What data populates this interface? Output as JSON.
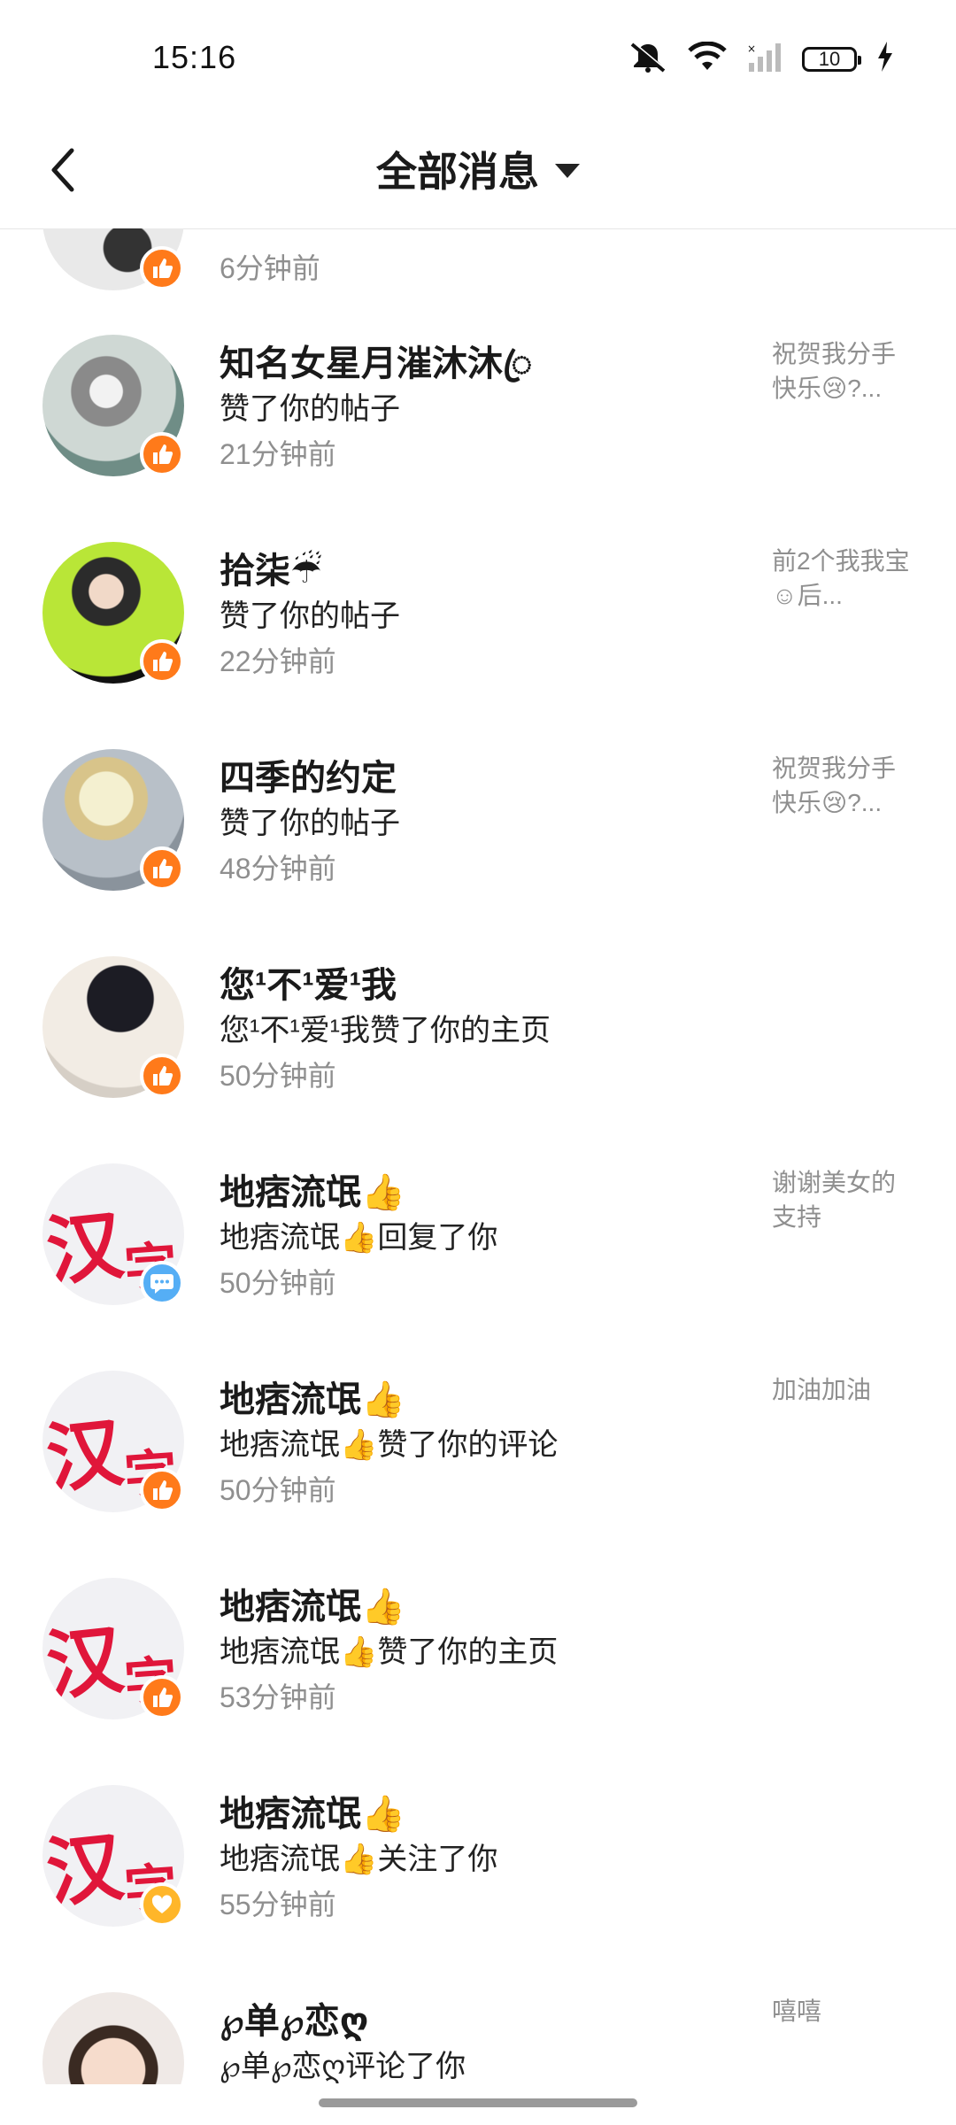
{
  "status_bar": {
    "time": "15:16",
    "battery": "10",
    "icons": [
      "mute-icon",
      "wifi-icon",
      "signal-icon",
      "battery-icon",
      "charging-icon"
    ]
  },
  "header": {
    "title": "全部消息",
    "back_icon": "chevron-left-icon",
    "dropdown_icon": "caret-down-icon"
  },
  "colors": {
    "like_badge": "#ff7a1a",
    "comment_badge": "#55aef5",
    "follow_badge": "#ffb629",
    "secondary_text": "#8f8f8f"
  },
  "messages": [
    {
      "name": "",
      "action": "",
      "time": "6分钟前",
      "preview": "",
      "badge": "like"
    },
    {
      "name": "知名女星月漼沐沐ꦿ",
      "action": "赞了你的帖子",
      "time": "21分钟前",
      "preview": "祝贺我分手快乐😢?...",
      "badge": "like"
    },
    {
      "name": "拾柒☔",
      "action": "赞了你的帖子",
      "time": "22分钟前",
      "preview": "前2个我我宝☺后...",
      "badge": "like"
    },
    {
      "name": "四季的约定",
      "action": "赞了你的帖子",
      "time": "48分钟前",
      "preview": "祝贺我分手快乐😢?...",
      "badge": "like"
    },
    {
      "name": "您¹不¹爱¹我",
      "action": "您¹不¹爱¹我赞了你的主页",
      "time": "50分钟前",
      "preview": "",
      "badge": "like"
    },
    {
      "name": "地痞流氓👍",
      "action": "地痞流氓👍回复了你",
      "time": "50分钟前",
      "preview": "谢谢美女的支持",
      "badge": "comment"
    },
    {
      "name": "地痞流氓👍",
      "action": "地痞流氓👍赞了你的评论",
      "time": "50分钟前",
      "preview": "加油加油",
      "badge": "like"
    },
    {
      "name": "地痞流氓👍",
      "action": "地痞流氓👍赞了你的主页",
      "time": "53分钟前",
      "preview": "",
      "badge": "like"
    },
    {
      "name": "地痞流氓👍",
      "action": "地痞流氓👍关注了你",
      "time": "55分钟前",
      "preview": "",
      "badge": "follow"
    },
    {
      "name": "℘单℘恋ღ",
      "action": "℘单℘恋ღ评论了你",
      "time": "",
      "preview": "嘻嘻",
      "badge": "none"
    }
  ],
  "avatar_text": {
    "hanzi_1": "汉",
    "hanzi_2": "字"
  }
}
